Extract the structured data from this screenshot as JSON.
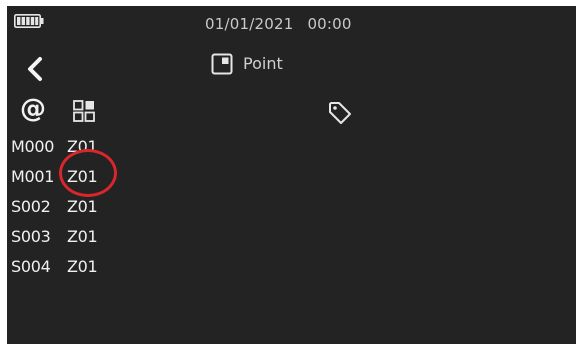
{
  "status_bar": {
    "date": "01/01/2021",
    "time": "00:00"
  },
  "header": {
    "mode_label": "Point"
  },
  "columns": {
    "address_symbol": "@"
  },
  "points": [
    {
      "id": "M000",
      "zone": "Z01"
    },
    {
      "id": "M001",
      "zone": "Z01"
    },
    {
      "id": "S002",
      "zone": "Z01"
    },
    {
      "id": "S003",
      "zone": "Z01"
    },
    {
      "id": "S004",
      "zone": "Z01"
    }
  ],
  "colors": {
    "background": "#232323",
    "text": "#f0f0f0",
    "highlight": "#d8262c"
  },
  "icons": [
    "battery-icon",
    "back-arrow-icon",
    "square-point-icon",
    "at-icon",
    "grid-icon",
    "tag-icon"
  ]
}
